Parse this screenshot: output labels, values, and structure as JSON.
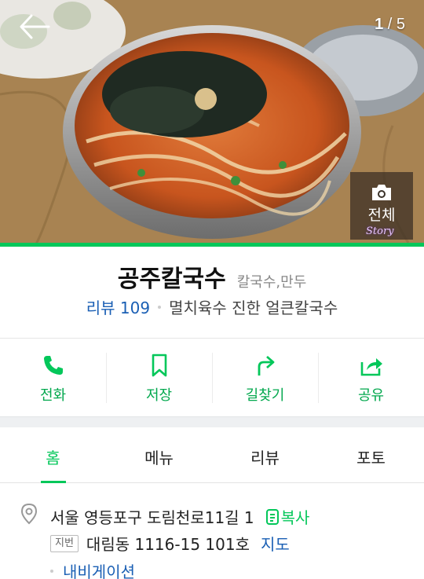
{
  "hero": {
    "counter_current": "1",
    "counter_total": "/ 5",
    "all_photos_label": "전체",
    "watermark": "Story",
    "back_icon": "arrow-left-icon",
    "camera_icon": "camera-icon"
  },
  "place": {
    "name": "공주칼국수",
    "category": "칼국수,만두",
    "review_label": "리뷰 109",
    "description": "멸치육수 진한 얼큰칼국수"
  },
  "actions": [
    {
      "label": "전화",
      "icon": "phone-icon"
    },
    {
      "label": "저장",
      "icon": "bookmark-icon"
    },
    {
      "label": "길찾기",
      "icon": "directions-icon"
    },
    {
      "label": "공유",
      "icon": "share-icon"
    }
  ],
  "tabs": [
    {
      "label": "홈",
      "active": true
    },
    {
      "label": "메뉴",
      "active": false
    },
    {
      "label": "리뷰",
      "active": false
    },
    {
      "label": "포토",
      "active": false
    }
  ],
  "address": {
    "road": "서울 영등포구 도림천로11길 1",
    "copy_label": "복사",
    "lot_badge": "지번",
    "lot": "대림동 1116-15 101호",
    "map_label": "지도",
    "navigation_label": "내비게이션"
  },
  "colors": {
    "accent_green": "#03c75a",
    "link_blue": "#1a5fb4"
  }
}
